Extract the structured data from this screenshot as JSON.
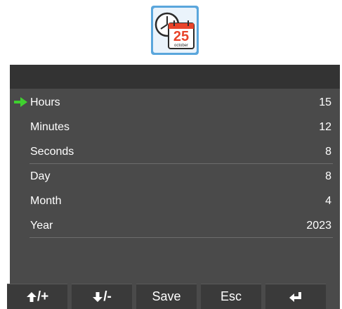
{
  "app_icon": {
    "icon": "clock-calendar-icon",
    "day": "25",
    "month": "october"
  },
  "title_bar": {
    "title": ""
  },
  "rows": [
    {
      "label": "Hours",
      "value": "15",
      "selected": true
    },
    {
      "label": "Minutes",
      "value": "12"
    },
    {
      "label": "Seconds",
      "value": "8"
    },
    {
      "label": "Day",
      "value": "8"
    },
    {
      "label": "Month",
      "value": "4"
    },
    {
      "label": "Year",
      "value": "2023"
    }
  ],
  "footer": {
    "up_label": "/+",
    "down_label": "/-",
    "save_label": "Save",
    "esc_label": "Esc",
    "enter_icon": "enter-icon"
  },
  "colors": {
    "selection_arrow": "#3fd12f",
    "frame": "#5aa6dc",
    "calendar_red": "#e8442a"
  }
}
